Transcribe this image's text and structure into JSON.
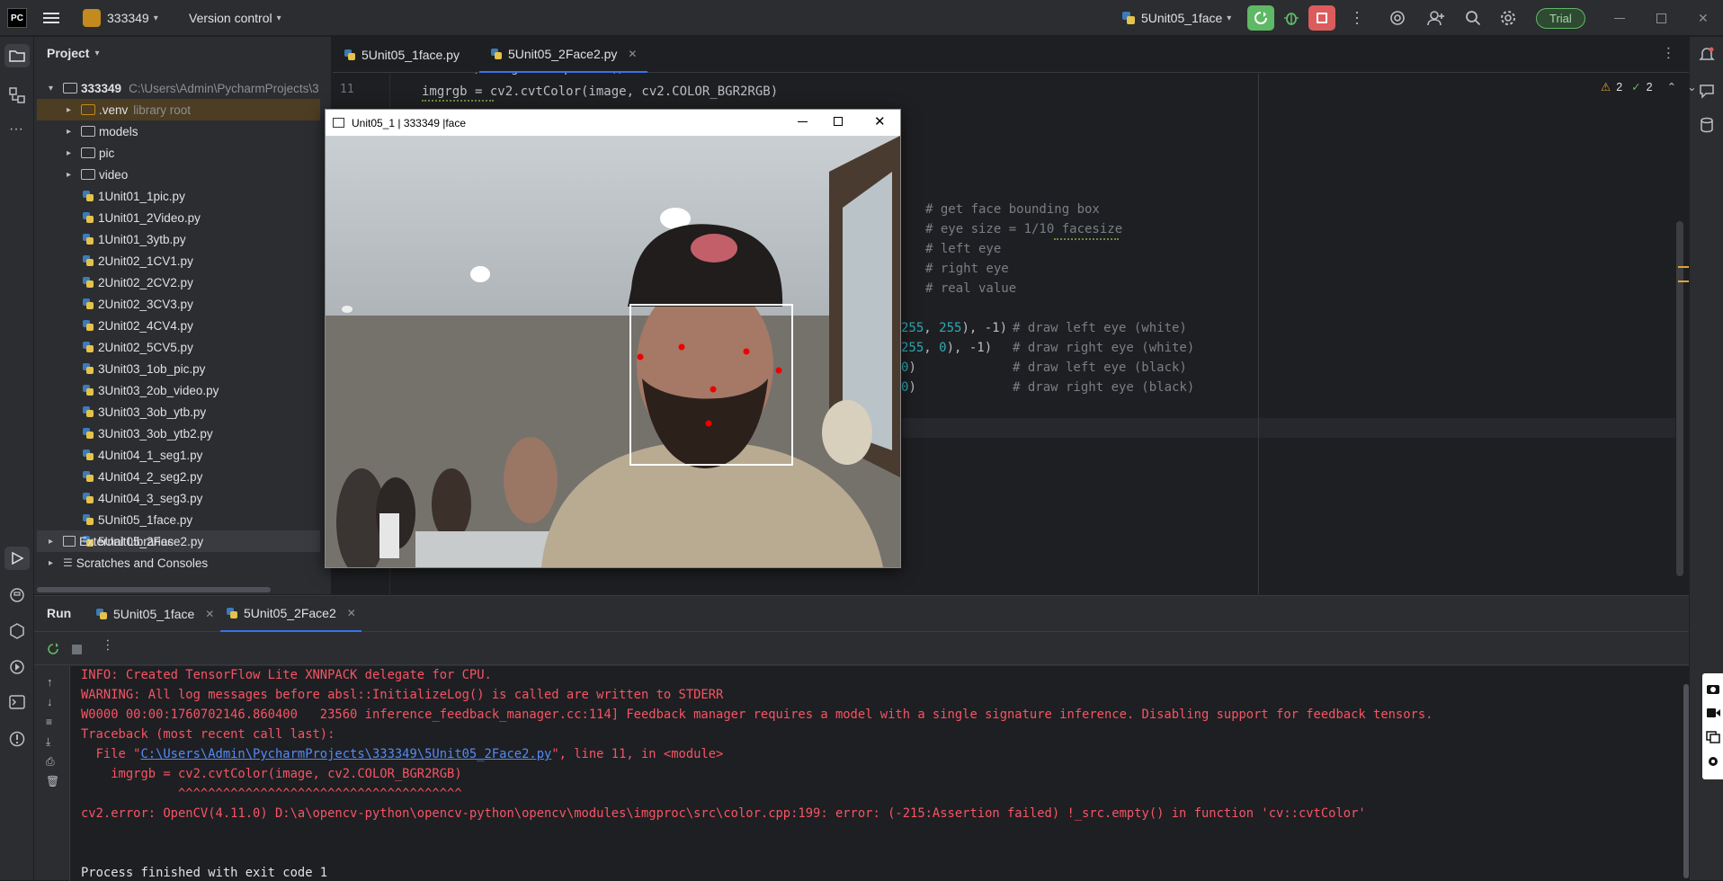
{
  "titlebar": {
    "app_logo": "PC",
    "project_name": "333349",
    "vcs_label": "Version control",
    "run_config": "5Unit05_1face",
    "trial_label": "Trial"
  },
  "project_panel": {
    "title": "Project",
    "root_name": "333349",
    "root_path": "C:\\Users\\Admin\\PycharmProjects\\3",
    "items": [
      {
        "label": "models",
        "type": "folder"
      },
      {
        "label": "pic",
        "type": "folder"
      },
      {
        "label": "video",
        "type": "folder"
      },
      {
        "label": "1Unit01_1pic.py",
        "type": "py"
      },
      {
        "label": "1Unit01_2Video.py",
        "type": "py"
      },
      {
        "label": "1Unit01_3ytb.py",
        "type": "py"
      },
      {
        "label": "2Unit02_1CV1.py",
        "type": "py"
      },
      {
        "label": "2Unit02_2CV2.py",
        "type": "py"
      },
      {
        "label": "2Unit02_3CV3.py",
        "type": "py"
      },
      {
        "label": "2Unit02_4CV4.py",
        "type": "py"
      },
      {
        "label": "2Unit02_5CV5.py",
        "type": "py"
      },
      {
        "label": "3Unit03_1ob_pic.py",
        "type": "py"
      },
      {
        "label": "3Unit03_2ob_video.py",
        "type": "py"
      },
      {
        "label": "3Unit03_3ob_ytb.py",
        "type": "py"
      },
      {
        "label": "3Unit03_3ob_ytb2.py",
        "type": "py"
      },
      {
        "label": "4Unit04_1_seg1.py",
        "type": "py"
      },
      {
        "label": "4Unit04_2_seg2.py",
        "type": "py"
      },
      {
        "label": "4Unit04_3_seg3.py",
        "type": "py"
      },
      {
        "label": "5Unit05_1face.py",
        "type": "py"
      },
      {
        "label": "5Unit05_2Face2.py",
        "type": "py"
      }
    ],
    "venv_label": ".venv",
    "venv_note": "library root",
    "external_libraries": "External Libraries",
    "scratches": "Scratches and Consoles"
  },
  "editor": {
    "tabs": [
      {
        "label": "5Unit05_1face.py"
      },
      {
        "label": "5Unit05_2Face2.py"
      }
    ],
    "inspections": {
      "warnings": "2",
      "ok": "2"
    },
    "line_number": "11",
    "line11_code": "imgrgb = cv2.cvtColor(image, cv2.COLOR_BGR2RGB)",
    "comments": [
      "# get face bounding box",
      "# eye size = 1/10 facesize",
      "# left eye",
      "# right eye",
      "# real value"
    ],
    "draw_lines": [
      {
        "a": "255",
        "b": "255",
        "tail": "), -1)",
        "comment": "# draw left eye (white)"
      },
      {
        "a": "255",
        "b": "0",
        "tail": "), -1)",
        "comment": "# draw right eye (white)"
      },
      {
        "a": "0",
        "b": "",
        "tail": ")",
        "comment": "# draw left eye (black)"
      },
      {
        "a": "0",
        "b": "",
        "tail": ")",
        "comment": "# draw right eye (black)"
      }
    ]
  },
  "cv_window": {
    "title": "Unit05_1 | 333349 |face"
  },
  "run_panel": {
    "title": "Run",
    "tabs": [
      {
        "label": "5Unit05_1face"
      },
      {
        "label": "5Unit05_2Face2"
      }
    ],
    "console": {
      "l1": "INFO: Created TensorFlow Lite XNNPACK delegate for CPU.",
      "l2": "WARNING: All log messages before absl::InitializeLog() is called are written to STDERR",
      "l3": "W0000 00:00:1760702146.860400   23560 inference_feedback_manager.cc:114] Feedback manager requires a model with a single signature inference. Disabling support for feedback tensors.",
      "l4": "Traceback (most recent call last):",
      "l5_pre": "  File \"",
      "l5_link": "C:\\Users\\Admin\\PycharmProjects\\333349\\5Unit05_2Face2.py",
      "l5_post": "\", line 11, in <module>",
      "l6": "    imgrgb = cv2.cvtColor(image, cv2.COLOR_BGR2RGB)",
      "l7": "             ^^^^^^^^^^^^^^^^^^^^^^^^^^^^^^^^^^^^^^",
      "l8": "cv2.error: OpenCV(4.11.0) D:\\a\\opencv-python\\opencv-python\\opencv\\modules\\imgproc\\src\\color.cpp:199: error: (-215:Assertion failed) !_src.empty() in function 'cv::cvtColor'",
      "l9": "Process finished with exit code 1"
    }
  },
  "colors": {
    "accent_green": "#5fb865",
    "stop_red": "#db5c5c",
    "error_text": "#f75464",
    "link": "#548af7",
    "comment": "#7a7e85"
  }
}
